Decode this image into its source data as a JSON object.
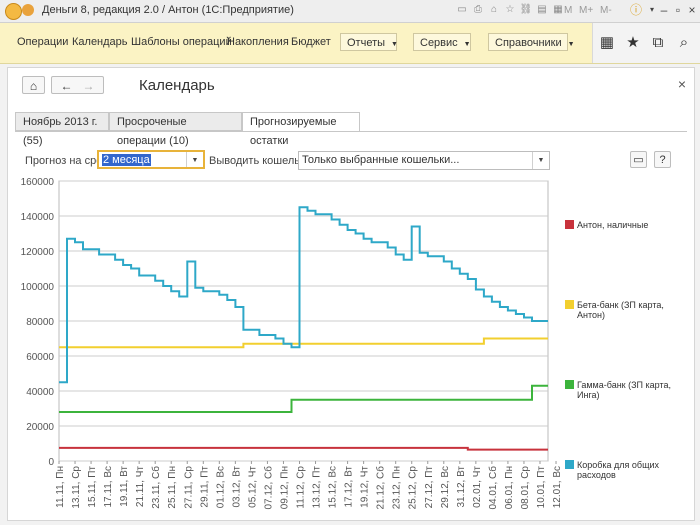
{
  "window": {
    "title": "Деньги 8, редакция 2.0 / Антон  (1С:Предприятие)",
    "toolbar_text": [
      "M",
      "M+",
      "M-"
    ]
  },
  "sections": {
    "items": [
      "Операции",
      "Календарь",
      "Шаблоны операций",
      "Накопления",
      "Бюджет"
    ],
    "dropdowns": [
      "Отчеты",
      "Сервис",
      "Справочники"
    ],
    "right_icons": [
      "grid-icon",
      "star-icon",
      "history-icon",
      "search-icon"
    ]
  },
  "form": {
    "title": "Календарь",
    "tabs": [
      "Ноябрь 2013 г.(55)",
      "Просроченые операции (10)",
      "Прогнозируемые остатки"
    ],
    "active_tab": 2,
    "forecast_label": "Прогноз на срок:",
    "forecast_value": "2 месяца",
    "wallets_label": "Выводить кошельки:",
    "wallets_value": "Только выбранные кошельки...",
    "help_label": "?"
  },
  "chart_data": {
    "type": "line",
    "ylim": [
      0,
      160000
    ],
    "yticks": [
      0,
      20000,
      40000,
      60000,
      80000,
      100000,
      120000,
      140000,
      160000
    ],
    "grid": true,
    "legend_position": "right",
    "xlim": [
      0,
      61
    ],
    "x_tick_labels": [
      "11.11, Пн",
      "13.11, Ср",
      "15.11, Пт",
      "17.11, Вс",
      "19.11, Вт",
      "21.11, Чт",
      "23.11, Сб",
      "25.11, Пн",
      "27.11, Ср",
      "29.11, Пт",
      "01.12, Вс",
      "03.12, Вт",
      "05.12, Чт",
      "07.12, Сб",
      "09.12, Пн",
      "11.12, Ср",
      "13.12, Пт",
      "15.12, Вс",
      "17.12, Вт",
      "19.12, Чт",
      "21.12, Сб",
      "23.12, Пн",
      "25.12, Ср",
      "27.12, Пт",
      "29.12, Вс",
      "31.12, Вт",
      "02.01, Чт",
      "04.01, Сб",
      "06.01, Пн",
      "08.01, Ср",
      "10.01, Пт",
      "12.01, Вс"
    ],
    "series": [
      {
        "name": "Антон,  наличные",
        "color": "#c8323c",
        "points": [
          [
            0,
            7500
          ],
          [
            51,
            7500
          ],
          [
            51,
            6500
          ],
          [
            61,
            6500
          ]
        ]
      },
      {
        "name": "Бета-банк (ЗП карта, Антон)",
        "color": "#f2cf2f",
        "points": [
          [
            0,
            65000
          ],
          [
            23,
            65000
          ],
          [
            23,
            67000
          ],
          [
            53,
            67000
          ],
          [
            53,
            70000
          ],
          [
            61,
            70000
          ]
        ]
      },
      {
        "name": "Гамма-банк (ЗП карта, Инга)",
        "color": "#3cb43c",
        "points": [
          [
            0,
            28000
          ],
          [
            29,
            28000
          ],
          [
            29,
            35000
          ],
          [
            59,
            35000
          ],
          [
            59,
            43000
          ],
          [
            61,
            43000
          ]
        ]
      },
      {
        "name": "Коробка для общих расходов",
        "color": "#2ea8c8",
        "points": [
          [
            0,
            45000
          ],
          [
            1,
            45000
          ],
          [
            1,
            127000
          ],
          [
            2,
            127000
          ],
          [
            2,
            125000
          ],
          [
            3,
            125000
          ],
          [
            3,
            121000
          ],
          [
            5,
            121000
          ],
          [
            5,
            118000
          ],
          [
            7,
            118000
          ],
          [
            7,
            115000
          ],
          [
            8,
            115000
          ],
          [
            8,
            112000
          ],
          [
            9,
            112000
          ],
          [
            9,
            110000
          ],
          [
            10,
            110000
          ],
          [
            10,
            106000
          ],
          [
            12,
            106000
          ],
          [
            12,
            103000
          ],
          [
            13,
            103000
          ],
          [
            13,
            100000
          ],
          [
            14,
            100000
          ],
          [
            14,
            97000
          ],
          [
            15,
            97000
          ],
          [
            15,
            94000
          ],
          [
            16,
            94000
          ],
          [
            16,
            114000
          ],
          [
            17,
            114000
          ],
          [
            17,
            99000
          ],
          [
            18,
            99000
          ],
          [
            18,
            97000
          ],
          [
            20,
            97000
          ],
          [
            20,
            95000
          ],
          [
            21,
            95000
          ],
          [
            21,
            92000
          ],
          [
            22,
            92000
          ],
          [
            22,
            88000
          ],
          [
            23,
            88000
          ],
          [
            23,
            75000
          ],
          [
            25,
            75000
          ],
          [
            25,
            72000
          ],
          [
            27,
            72000
          ],
          [
            27,
            70000
          ],
          [
            28,
            70000
          ],
          [
            28,
            67000
          ],
          [
            29,
            67000
          ],
          [
            29,
            65000
          ],
          [
            30,
            65000
          ],
          [
            30,
            145000
          ],
          [
            31,
            145000
          ],
          [
            31,
            143000
          ],
          [
            32,
            143000
          ],
          [
            32,
            141000
          ],
          [
            34,
            141000
          ],
          [
            34,
            138000
          ],
          [
            35,
            138000
          ],
          [
            35,
            135000
          ],
          [
            36,
            135000
          ],
          [
            36,
            132000
          ],
          [
            37,
            132000
          ],
          [
            37,
            130000
          ],
          [
            38,
            130000
          ],
          [
            38,
            127000
          ],
          [
            39,
            127000
          ],
          [
            39,
            125000
          ],
          [
            41,
            125000
          ],
          [
            41,
            122000
          ],
          [
            42,
            122000
          ],
          [
            42,
            118000
          ],
          [
            43,
            118000
          ],
          [
            43,
            115000
          ],
          [
            44,
            115000
          ],
          [
            44,
            134000
          ],
          [
            45,
            134000
          ],
          [
            45,
            119000
          ],
          [
            46,
            119000
          ],
          [
            46,
            117000
          ],
          [
            48,
            117000
          ],
          [
            48,
            114000
          ],
          [
            49,
            114000
          ],
          [
            49,
            110000
          ],
          [
            50,
            110000
          ],
          [
            50,
            107000
          ],
          [
            51,
            107000
          ],
          [
            51,
            104000
          ],
          [
            52,
            104000
          ],
          [
            52,
            98000
          ],
          [
            53,
            98000
          ],
          [
            53,
            94000
          ],
          [
            54,
            94000
          ],
          [
            54,
            91000
          ],
          [
            55,
            91000
          ],
          [
            55,
            88000
          ],
          [
            56,
            88000
          ],
          [
            56,
            86000
          ],
          [
            57,
            86000
          ],
          [
            57,
            84000
          ],
          [
            58,
            84000
          ],
          [
            58,
            82000
          ],
          [
            59,
            82000
          ],
          [
            59,
            80000
          ],
          [
            61,
            80000
          ]
        ]
      }
    ]
  }
}
